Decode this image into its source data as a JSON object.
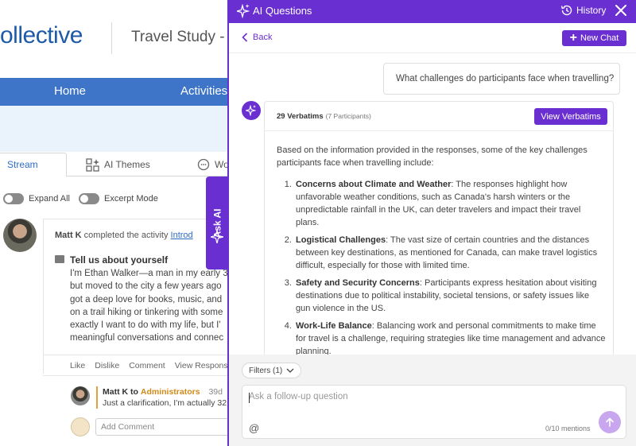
{
  "app": {
    "logo_text": "ollective",
    "page_title": "Travel Study - N",
    "nav": [
      "Home",
      "Activities"
    ],
    "tabs": [
      "Stream",
      "AI Themes",
      "Wo"
    ],
    "toggles": [
      "Expand All",
      "Excerpt Mode"
    ],
    "ask_ai_label": "Ask AI"
  },
  "post": {
    "author": "Matt K",
    "action": "completed the activity",
    "activity_link": "Introd",
    "question_title": "Tell us about yourself",
    "body_lines": [
      "I'm Ethan Walker—a man in my early 3",
      "but moved to the city a few years ago",
      "got a deep love for books, music, and",
      "on a trail hiking or tinkering with some",
      "exactly I want to do with my life, but I'",
      "meaningful conversations and connec"
    ],
    "actions": [
      "Like",
      "Dislike",
      "Comment",
      "View Respons"
    ],
    "reply": {
      "author": "Matt K",
      "to_word": "to",
      "audience": "Administrators",
      "age": "39d",
      "text": "Just a clarification, I'm actually 32"
    },
    "add_comment_placeholder": "Add Comment"
  },
  "panel": {
    "title": "AI Questions",
    "history_label": "History",
    "back_label": "Back",
    "new_chat_label": "New Chat",
    "user_question": "What challenges do participants face when travelling?",
    "response": {
      "verbatims_count": "29 Verbatims",
      "participants": "(7 Participants)",
      "view_verbatims_label": "View Verbatims",
      "intro": "Based on the information provided in the responses, some of the key challenges participants face when travelling include:",
      "items": [
        {
          "title": "Concerns about Climate and Weather",
          "text": ": The responses highlight how unfavorable weather conditions, such as Canada's harsh winters or the unpredictable rainfall in the UK, can deter travelers and impact their travel plans."
        },
        {
          "title": "Logistical Challenges",
          "text": ": The vast size of certain countries and the distances between key destinations, as mentioned for Canada, can make travel logistics difficult, especially for those with limited time."
        },
        {
          "title": "Safety and Security Concerns",
          "text": ": Participants express hesitation about visiting destinations due to political instability, societal tensions, or safety issues like gun violence in the US."
        },
        {
          "title": "Work-Life Balance",
          "text": ": Balancing work and personal commitments to make time for travel is a challenge, requiring strategies like time management and advance planning."
        }
      ]
    },
    "filters_label": "Filters (1)",
    "followup_placeholder": "Ask a follow-up question",
    "mentions": "0/10 mentions"
  },
  "colors": {
    "accent": "#6a2fd0",
    "nav_blue": "#3e75c9",
    "send_disabled": "#c9a7ef"
  }
}
